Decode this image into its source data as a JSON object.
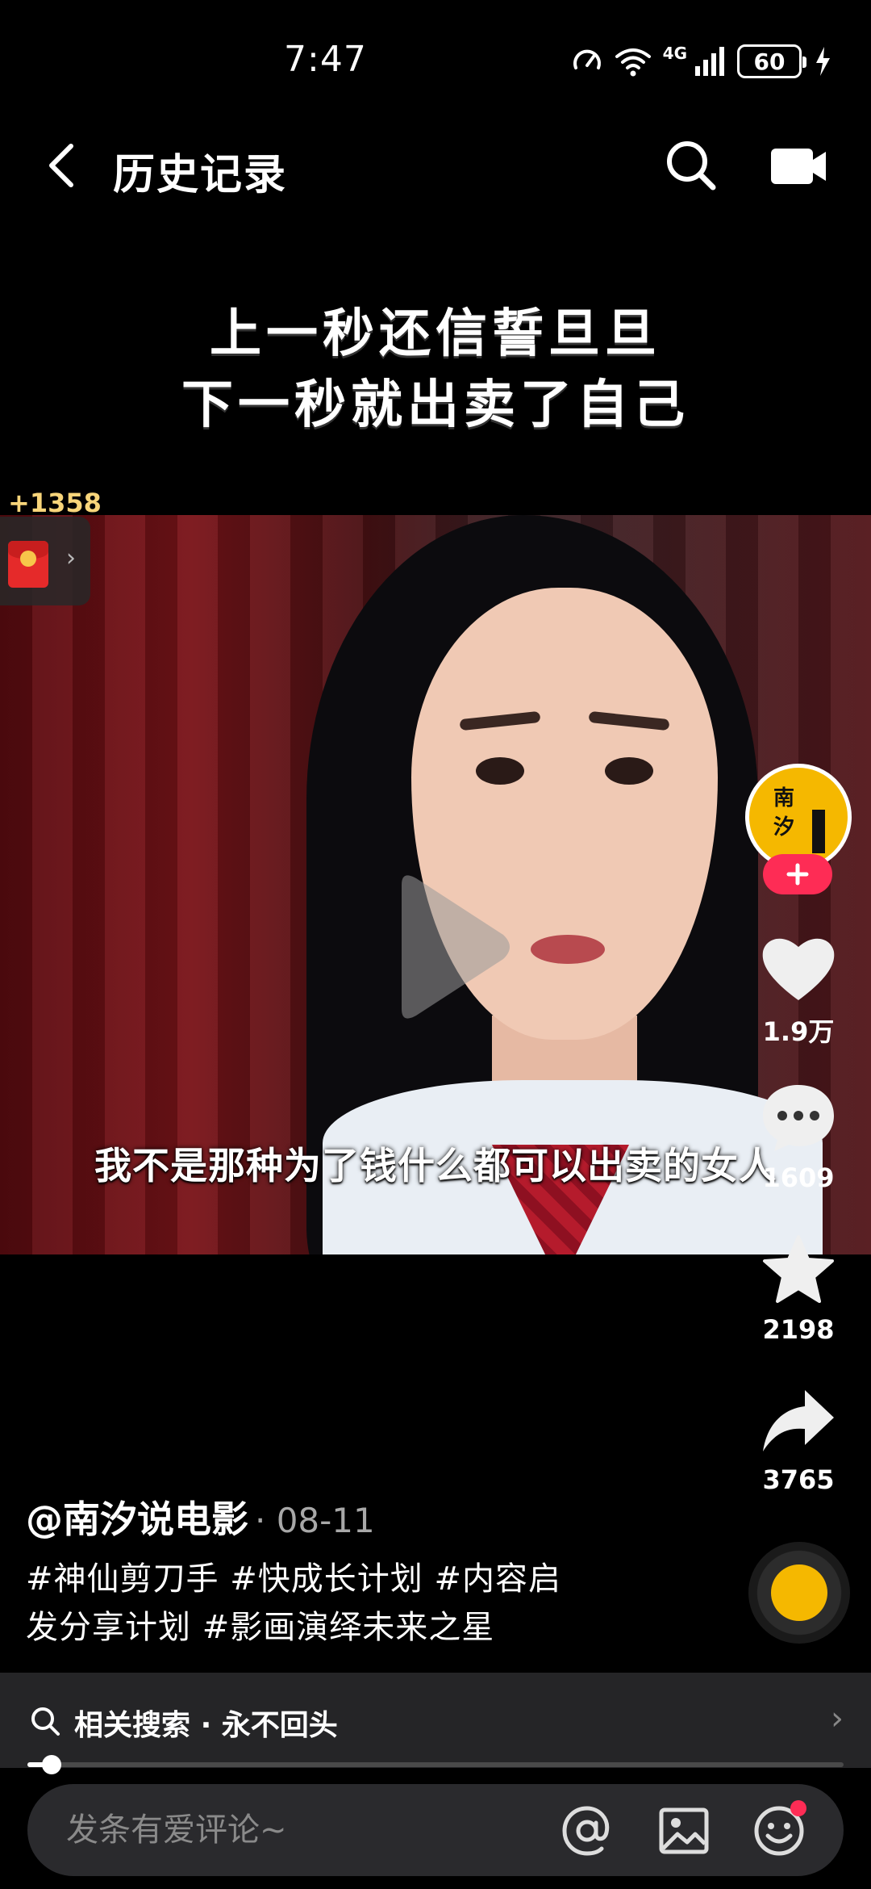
{
  "status_bar": {
    "time": "7:47",
    "network": "4G",
    "battery": "60"
  },
  "header": {
    "title": "历史记录"
  },
  "video": {
    "caption_line1": "上一秒还信誓旦旦",
    "caption_line2": "下一秒就出卖了自己",
    "subtitle": "我不是那种为了钱什么都可以出卖的女人"
  },
  "reward": {
    "count": "+1358"
  },
  "author": {
    "avatar_text_1": "南",
    "avatar_text_2": "汐",
    "handle": "@南汐说电影",
    "date": "· 08-11"
  },
  "actions": {
    "likes": "1.9万",
    "comments": "1609",
    "favorites": "2198",
    "shares": "3765"
  },
  "description": {
    "line1": "#神仙剪刀手 #快成长计划 #内容启",
    "line2": "发分享计划 #影画演绎未来之星"
  },
  "related_search": {
    "label": "相关搜索",
    "separator": "·",
    "query": "永不回头"
  },
  "progress": {
    "fraction": 0.03
  },
  "comment_bar": {
    "placeholder": "发条有爱评论~"
  },
  "colors": {
    "accent": "#fe2c55",
    "avatar_bg": "#f5b800",
    "reward_text": "#f8d57a"
  }
}
